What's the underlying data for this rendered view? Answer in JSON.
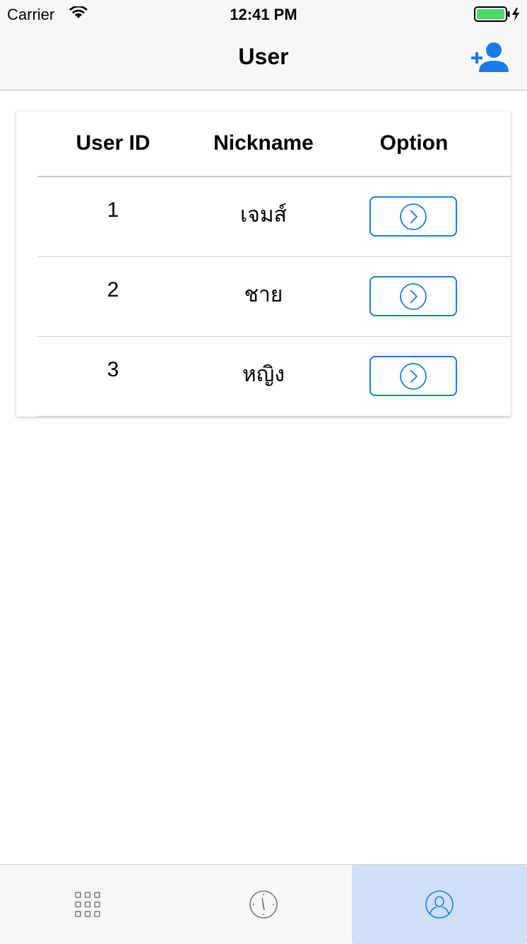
{
  "status_bar": {
    "carrier": "Carrier",
    "time": "12:41 PM"
  },
  "nav": {
    "title": "User",
    "add_user_icon": "person-add-icon"
  },
  "table": {
    "columns": [
      "User ID",
      "Nickname",
      "Option"
    ],
    "rows": [
      {
        "id": "1",
        "nickname": "เจมส์",
        "option_icon": "chevron-right-circle-icon"
      },
      {
        "id": "2",
        "nickname": "ชาย",
        "option_icon": "chevron-right-circle-icon"
      },
      {
        "id": "3",
        "nickname": "หญิง",
        "option_icon": "chevron-right-circle-icon"
      }
    ]
  },
  "tab_bar": {
    "tabs": [
      {
        "icon": "grid-icon",
        "active": false
      },
      {
        "icon": "clock-icon",
        "active": false
      },
      {
        "icon": "user-circle-icon",
        "active": true
      }
    ]
  },
  "colors": {
    "accent": "#1a7be6",
    "active_tab_bg": "#cfe0f6",
    "bar_bg": "#f7f7f7",
    "battery": "#4cd964"
  }
}
